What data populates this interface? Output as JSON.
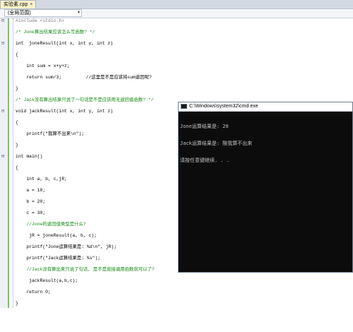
{
  "tab": {
    "title": "实验素.cpp",
    "close": "×"
  },
  "scope": {
    "label": "(全局范围)",
    "arrow": "▾"
  },
  "code": [
    {
      "text": "#include <stdio.h>",
      "cls": "pp"
    },
    {
      "text": "",
      "cls": ""
    },
    {
      "text": "/* Jone算出结果应该怎么写函数? */",
      "cls": "cm"
    },
    {
      "text": "",
      "cls": ""
    },
    {
      "text": "int  joneResult(int x, int y, int z)",
      "cls": ""
    },
    {
      "text": "",
      "cls": ""
    },
    {
      "text": "{",
      "cls": ""
    },
    {
      "text": "",
      "cls": ""
    },
    {
      "text": "    int sum = x+y+z;",
      "cls": ""
    },
    {
      "text": "",
      "cls": ""
    },
    {
      "text": "    return sum/3;         //这里是不是应该将sum返回呢?",
      "cls": ""
    },
    {
      "text": "",
      "cls": ""
    },
    {
      "text": "}",
      "cls": ""
    },
    {
      "text": "",
      "cls": ""
    },
    {
      "text": "/* Jack没有算出结果只说了一句话是不是应该用无返回值函数? */",
      "cls": "cm"
    },
    {
      "text": "",
      "cls": ""
    },
    {
      "text": "void jackResult(int x, int y, int z)",
      "cls": ""
    },
    {
      "text": "",
      "cls": ""
    },
    {
      "text": "{",
      "cls": ""
    },
    {
      "text": "",
      "cls": ""
    },
    {
      "text": "    printf(\"我算不出来\\n\");",
      "cls": ""
    },
    {
      "text": "",
      "cls": ""
    },
    {
      "text": "}",
      "cls": ""
    },
    {
      "text": "",
      "cls": ""
    },
    {
      "text": "int main()",
      "cls": ""
    },
    {
      "text": "",
      "cls": ""
    },
    {
      "text": "{",
      "cls": ""
    },
    {
      "text": "",
      "cls": ""
    },
    {
      "text": "    int a, b, c,jR;",
      "cls": ""
    },
    {
      "text": "",
      "cls": ""
    },
    {
      "text": "    a = 10;",
      "cls": ""
    },
    {
      "text": "",
      "cls": ""
    },
    {
      "text": "    b = 20;",
      "cls": ""
    },
    {
      "text": "",
      "cls": ""
    },
    {
      "text": "    c = 30;",
      "cls": ""
    },
    {
      "text": "",
      "cls": ""
    },
    {
      "text": "    //Jone的返回值类型是什么?",
      "cls": "cm"
    },
    {
      "text": "",
      "cls": ""
    },
    {
      "text": "     jR = joneResult(a, b, c);",
      "cls": ""
    },
    {
      "text": "",
      "cls": ""
    },
    {
      "text": "    printf(\"Jone运算结果是: %d\\n\", jR);",
      "cls": ""
    },
    {
      "text": "",
      "cls": ""
    },
    {
      "text": "    printf(\"Jack运算结果是: %s\");",
      "cls": ""
    },
    {
      "text": "",
      "cls": ""
    },
    {
      "text": "    //Jack没有算出来只说了句话, 是不是直接调用函数就可以了?",
      "cls": "cm"
    },
    {
      "text": "",
      "cls": ""
    },
    {
      "text": "     jackResult(a,b,c);",
      "cls": ""
    },
    {
      "text": "",
      "cls": ""
    },
    {
      "text": "    return 0;",
      "cls": ""
    },
    {
      "text": "",
      "cls": ""
    },
    {
      "text": "}",
      "cls": ""
    }
  ],
  "cmd": {
    "title": "C:\\Windows\\system32\\cmd.exe",
    "lines": [
      "Jone运算结果是: 20",
      "Jack运算结果是: 酸我算不出来",
      "请按任意键继续. . ."
    ]
  },
  "fold_marker": "⊟"
}
